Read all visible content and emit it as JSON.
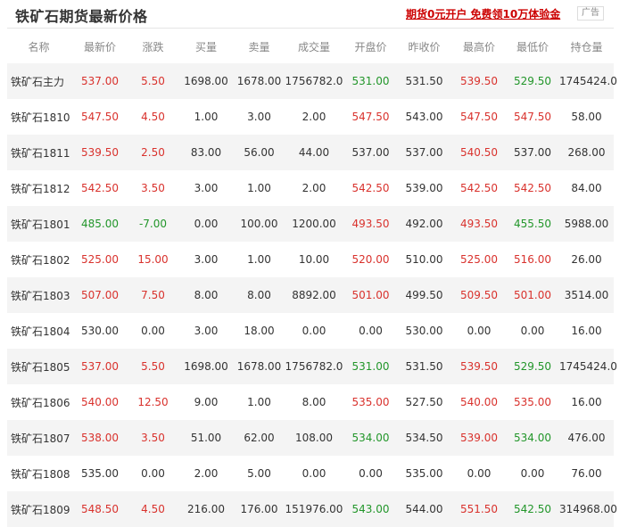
{
  "header": {
    "title": "铁矿石期货最新价格",
    "promo": "期货0元开户 免费领10万体验金",
    "ad_tag": "广告"
  },
  "colors": {
    "up": "#d9322d",
    "down": "#22962a",
    "flat": "#333333"
  },
  "columns": [
    "名称",
    "最新价",
    "涨跌",
    "买量",
    "卖量",
    "成交量",
    "开盘价",
    "昨收价",
    "最高价",
    "最低价",
    "持仓量"
  ],
  "rows": [
    {
      "name": "铁矿石主力",
      "last": "537.00",
      "change": "5.50",
      "bid_vol": "1698.00",
      "ask_vol": "1678.00",
      "volume": "1756782.0",
      "open": "531.00",
      "prev_close": "531.50",
      "high": "539.50",
      "low": "529.50",
      "oi": "1745424.0",
      "c": {
        "last": "up",
        "change": "up",
        "open": "down",
        "high": "up",
        "low": "down"
      }
    },
    {
      "name": "铁矿石1810",
      "last": "547.50",
      "change": "4.50",
      "bid_vol": "1.00",
      "ask_vol": "3.00",
      "volume": "2.00",
      "open": "547.50",
      "prev_close": "543.00",
      "high": "547.50",
      "low": "547.50",
      "oi": "58.00",
      "c": {
        "last": "up",
        "change": "up",
        "open": "up",
        "high": "up",
        "low": "up"
      }
    },
    {
      "name": "铁矿石1811",
      "last": "539.50",
      "change": "2.50",
      "bid_vol": "83.00",
      "ask_vol": "56.00",
      "volume": "44.00",
      "open": "537.00",
      "prev_close": "537.00",
      "high": "540.50",
      "low": "537.00",
      "oi": "268.00",
      "c": {
        "last": "up",
        "change": "up",
        "open": "flat",
        "high": "up",
        "low": "flat"
      }
    },
    {
      "name": "铁矿石1812",
      "last": "542.50",
      "change": "3.50",
      "bid_vol": "3.00",
      "ask_vol": "1.00",
      "volume": "2.00",
      "open": "542.50",
      "prev_close": "539.00",
      "high": "542.50",
      "low": "542.50",
      "oi": "84.00",
      "c": {
        "last": "up",
        "change": "up",
        "open": "up",
        "high": "up",
        "low": "up"
      }
    },
    {
      "name": "铁矿石1801",
      "last": "485.00",
      "change": "-7.00",
      "bid_vol": "0.00",
      "ask_vol": "100.00",
      "volume": "1200.00",
      "open": "493.50",
      "prev_close": "492.00",
      "high": "493.50",
      "low": "455.50",
      "oi": "5988.00",
      "c": {
        "last": "down",
        "change": "down",
        "open": "up",
        "high": "up",
        "low": "down"
      }
    },
    {
      "name": "铁矿石1802",
      "last": "525.00",
      "change": "15.00",
      "bid_vol": "3.00",
      "ask_vol": "1.00",
      "volume": "10.00",
      "open": "520.00",
      "prev_close": "510.00",
      "high": "525.00",
      "low": "516.00",
      "oi": "26.00",
      "c": {
        "last": "up",
        "change": "up",
        "open": "up",
        "high": "up",
        "low": "up"
      }
    },
    {
      "name": "铁矿石1803",
      "last": "507.00",
      "change": "7.50",
      "bid_vol": "8.00",
      "ask_vol": "8.00",
      "volume": "8892.00",
      "open": "501.00",
      "prev_close": "499.50",
      "high": "509.50",
      "low": "501.00",
      "oi": "3514.00",
      "c": {
        "last": "up",
        "change": "up",
        "open": "up",
        "high": "up",
        "low": "up"
      }
    },
    {
      "name": "铁矿石1804",
      "last": "530.00",
      "change": "0.00",
      "bid_vol": "3.00",
      "ask_vol": "18.00",
      "volume": "0.00",
      "open": "0.00",
      "prev_close": "530.00",
      "high": "0.00",
      "low": "0.00",
      "oi": "16.00",
      "c": {
        "last": "flat",
        "change": "flat",
        "open": "flat",
        "high": "flat",
        "low": "flat"
      }
    },
    {
      "name": "铁矿石1805",
      "last": "537.00",
      "change": "5.50",
      "bid_vol": "1698.00",
      "ask_vol": "1678.00",
      "volume": "1756782.0",
      "open": "531.00",
      "prev_close": "531.50",
      "high": "539.50",
      "low": "529.50",
      "oi": "1745424.0",
      "c": {
        "last": "up",
        "change": "up",
        "open": "down",
        "high": "up",
        "low": "down"
      }
    },
    {
      "name": "铁矿石1806",
      "last": "540.00",
      "change": "12.50",
      "bid_vol": "9.00",
      "ask_vol": "1.00",
      "volume": "8.00",
      "open": "535.00",
      "prev_close": "527.50",
      "high": "540.00",
      "low": "535.00",
      "oi": "16.00",
      "c": {
        "last": "up",
        "change": "up",
        "open": "up",
        "high": "up",
        "low": "up"
      }
    },
    {
      "name": "铁矿石1807",
      "last": "538.00",
      "change": "3.50",
      "bid_vol": "51.00",
      "ask_vol": "62.00",
      "volume": "108.00",
      "open": "534.00",
      "prev_close": "534.50",
      "high": "539.00",
      "low": "534.00",
      "oi": "476.00",
      "c": {
        "last": "up",
        "change": "up",
        "open": "down",
        "high": "up",
        "low": "down"
      }
    },
    {
      "name": "铁矿石1808",
      "last": "535.00",
      "change": "0.00",
      "bid_vol": "2.00",
      "ask_vol": "5.00",
      "volume": "0.00",
      "open": "0.00",
      "prev_close": "535.00",
      "high": "0.00",
      "low": "0.00",
      "oi": "76.00",
      "c": {
        "last": "flat",
        "change": "flat",
        "open": "flat",
        "high": "flat",
        "low": "flat"
      }
    },
    {
      "name": "铁矿石1809",
      "last": "548.50",
      "change": "4.50",
      "bid_vol": "216.00",
      "ask_vol": "176.00",
      "volume": "151976.00",
      "open": "543.00",
      "prev_close": "544.00",
      "high": "551.50",
      "low": "542.50",
      "oi": "314968.00",
      "c": {
        "last": "up",
        "change": "up",
        "open": "down",
        "high": "up",
        "low": "down"
      }
    }
  ]
}
